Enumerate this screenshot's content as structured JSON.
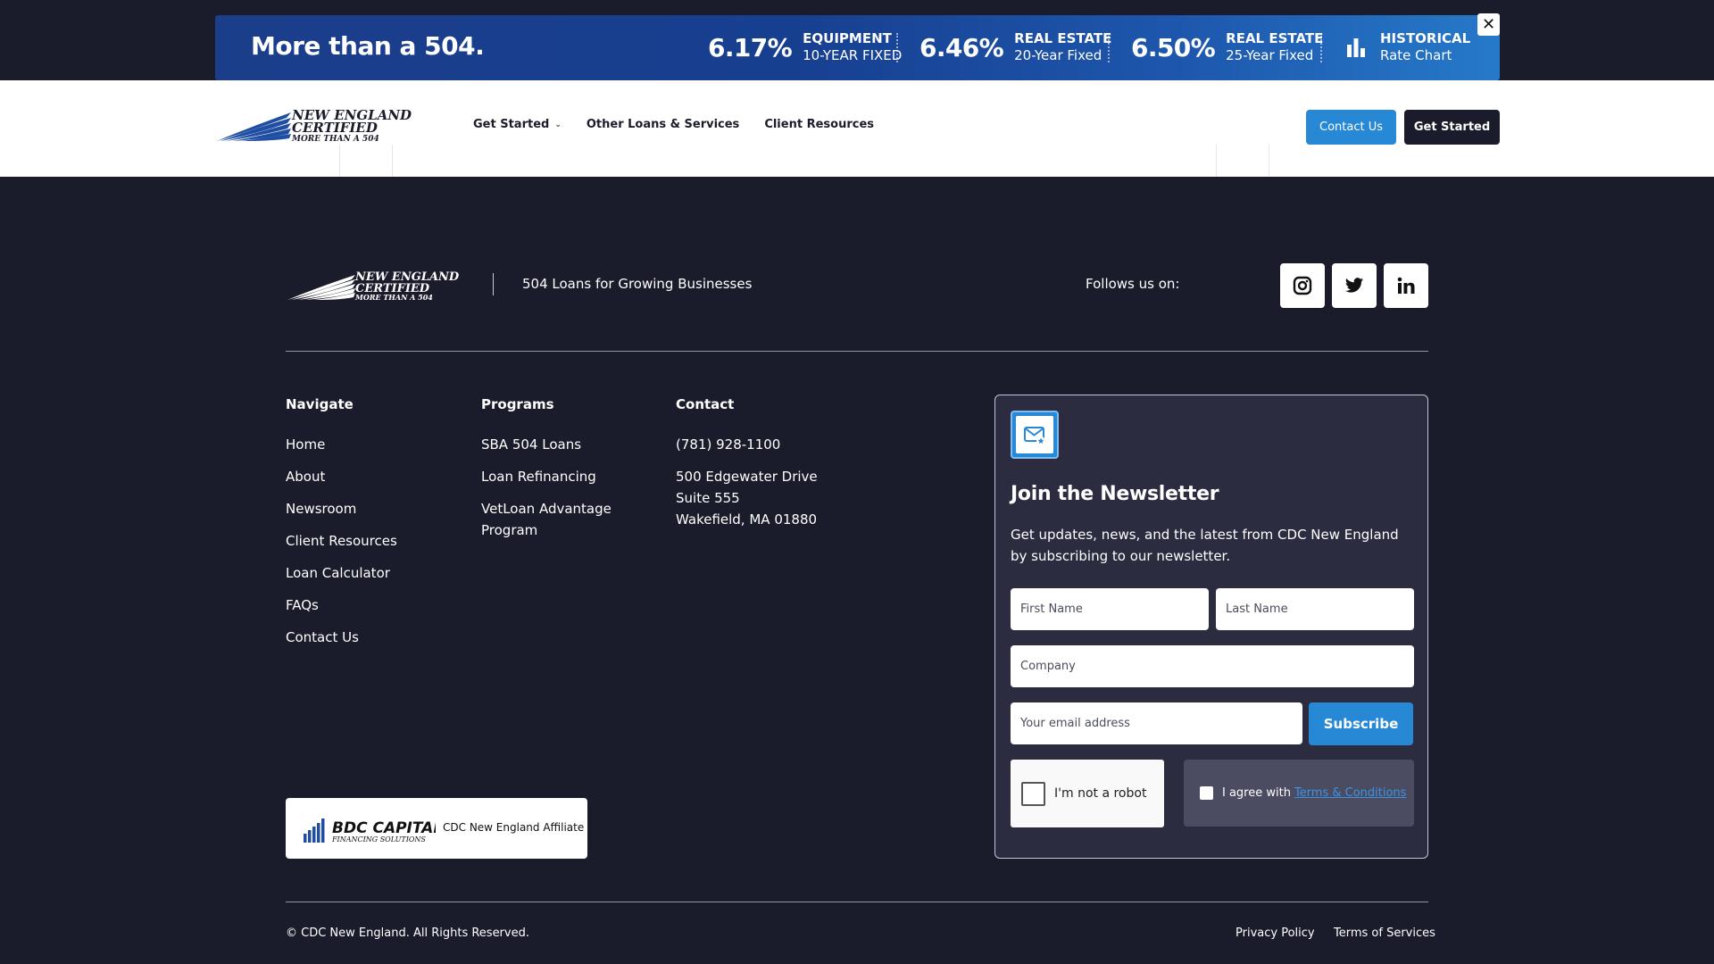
{
  "banner": {
    "headline": "More than a 504.",
    "rates": [
      {
        "pct": "6.17%",
        "line1": "EQUIPMENT",
        "line2": "10-YEAR FIXED"
      },
      {
        "pct": "6.46%",
        "line1": "REAL ESTATE",
        "line2": "20-Year Fixed"
      },
      {
        "pct": "6.50%",
        "line1": "REAL ESTATE",
        "line2": "25-Year Fixed"
      }
    ],
    "historical": {
      "line1": "HISTORICAL",
      "line2": "Rate Chart"
    },
    "close_label": "✕"
  },
  "header": {
    "logo": {
      "line1": "NEW ENGLAND",
      "line2": "CERTIFIED",
      "line3": "MORE THAN A 504"
    },
    "nav": [
      "Get Started",
      "Other Loans & Services",
      "Client Resources"
    ],
    "contact_button": "Contact Us",
    "start_button": "Get Started"
  },
  "footer": {
    "tagline": "504 Loans for Growing Businesses",
    "follow_label": "Follows us on:",
    "social": [
      "instagram-icon",
      "twitter-icon",
      "linkedin-icon"
    ],
    "navigate": {
      "heading": "Navigate",
      "links": [
        "Home",
        "About",
        "Newsroom",
        "Client Resources",
        "Loan Calculator",
        "FAQs",
        "Contact Us"
      ]
    },
    "programs": {
      "heading": "Programs",
      "links": [
        "SBA 504 Loans",
        "Loan Refinancing",
        "VetLoan Advantage",
        "Program"
      ]
    },
    "contact": {
      "heading": "Contact",
      "phone": "(781) 928-1100",
      "address": [
        "500 Edgewater Drive",
        "Suite 555",
        "Wakefield, MA 01880"
      ]
    },
    "newsletter": {
      "title": "Join the Newsletter",
      "description": "Get updates, news, and the latest from CDC New England by subscribing to our newsletter.",
      "first_name": "First Name",
      "last_name": "Last Name",
      "company": "Company",
      "email": "Your email address",
      "subscribe": "Subscribe",
      "captcha": "I'm not a robot",
      "agree_text": "I agree with",
      "terms_link": "Terms & Conditions"
    },
    "bdc": {
      "name": "BDC CAPITAL",
      "sub": "FINANCING SOLUTIONS",
      "affiliate": "CDC New England Affiliate"
    },
    "copyright": "© CDC New England. All Rights Reserved.",
    "privacy": "Privacy Policy",
    "terms": "Terms of Services"
  },
  "colors": {
    "accent": "#2789d6",
    "dark": "#1b1c2b",
    "banner": "#1b3e8a"
  }
}
